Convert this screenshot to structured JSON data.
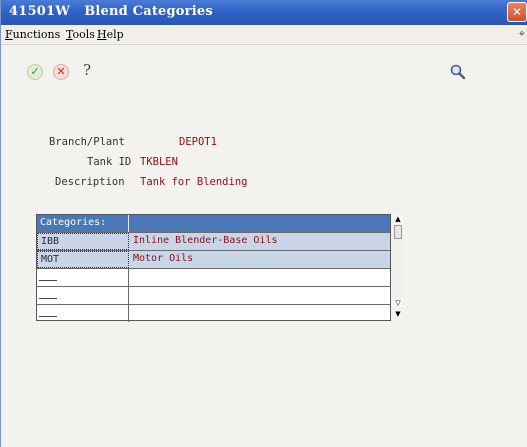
{
  "window": {
    "title": "41501W   Blend Categories"
  },
  "menu": {
    "items": [
      "Functions",
      "Tools",
      "Help"
    ]
  },
  "toolbar": {
    "help_glyph": "?"
  },
  "form": {
    "branch_plant": {
      "label": "Branch/Plant",
      "value": "DEPOT1"
    },
    "tank_id": {
      "label": "Tank ID",
      "value": "TKBLEN"
    },
    "description": {
      "label": "Description",
      "value": "Tank for Blending"
    }
  },
  "grid": {
    "header": {
      "categories": "Categories:",
      "description": ""
    },
    "rows": [
      {
        "code": "IBB",
        "description": "Inline Blender-Base Oils"
      },
      {
        "code": "MOT",
        "description": "Motor Oils"
      },
      {
        "code": "",
        "description": ""
      },
      {
        "code": "",
        "description": ""
      },
      {
        "code": "",
        "description": ""
      }
    ]
  },
  "colors": {
    "titlebar": "#2f63c6",
    "grid_header": "#4a78b6",
    "value_text": "#8a0f12",
    "selected_row": "#c9d6ea"
  }
}
